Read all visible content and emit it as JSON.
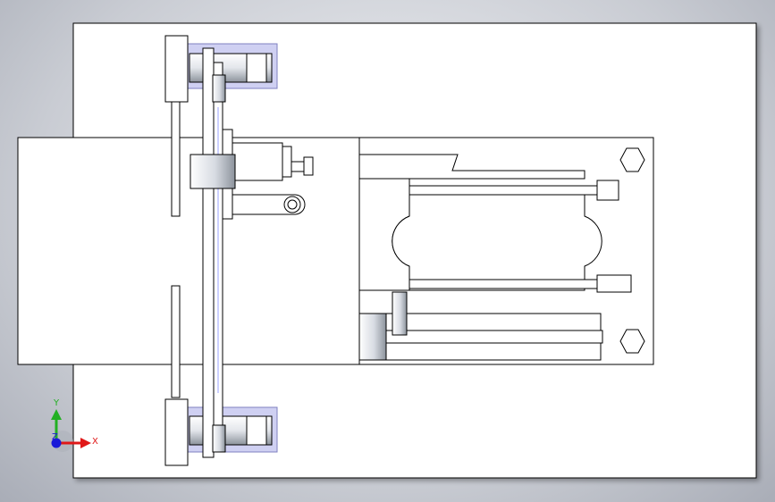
{
  "view": {
    "background_top": "#f4f5f8",
    "background_bottom": "#a9adb7",
    "part_fill": "#ffffff",
    "edge_color": "#000000",
    "housing_fill": "#cfd0f2",
    "housing_stroke": "#7f80c0",
    "shade_color": "#9aa0aa"
  },
  "triad": {
    "x_label": "X",
    "y_label": "Y",
    "z_label": "Z",
    "x_color": "#e01818",
    "y_color": "#22b022",
    "z_color": "#1a1ad8"
  }
}
